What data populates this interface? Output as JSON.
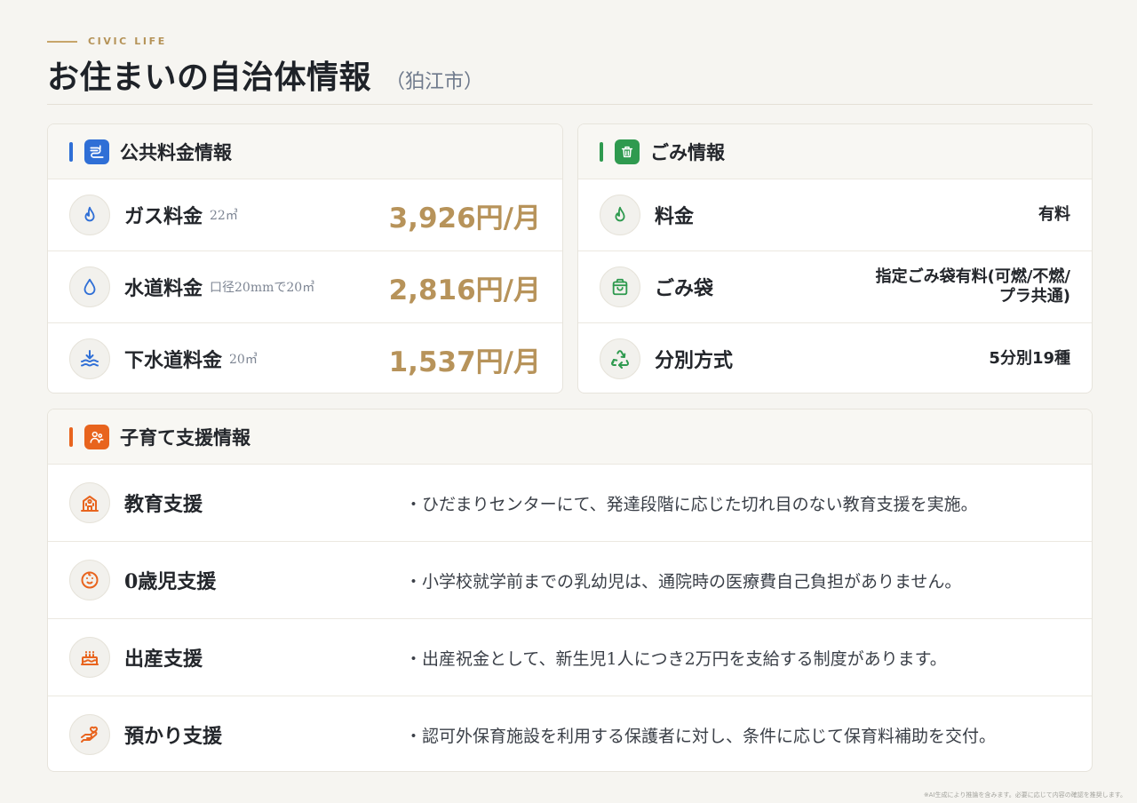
{
  "header": {
    "eyebrow": "CIVIC LIFE",
    "title": "お住まいの自治体情報",
    "subtitle": "（狛江市）"
  },
  "utilities": {
    "title": "公共料金情報",
    "accent_color": "#2f6fd6",
    "items": [
      {
        "label": "ガス料金",
        "note": "22㎥",
        "amount": "3,926円/月",
        "icon": "flame-icon"
      },
      {
        "label": "水道料金",
        "note": "口径20mmで20㎥",
        "amount": "2,816円/月",
        "icon": "water-drop-icon"
      },
      {
        "label": "下水道料金",
        "note": "20㎥",
        "amount": "1,537円/月",
        "icon": "sewage-icon"
      }
    ]
  },
  "garbage": {
    "title": "ごみ情報",
    "accent_color": "#2f9a4f",
    "items": [
      {
        "label": "料金",
        "value": "有料",
        "icon": "leaf-flame-icon"
      },
      {
        "label": "ごみ袋",
        "value_line1": "指定ごみ袋有料(可燃/不燃/",
        "value_line2": "プラ共通)",
        "icon": "bag-icon"
      },
      {
        "label": "分別方式",
        "value": "5分別19種",
        "icon": "recycle-icon"
      }
    ]
  },
  "childcare": {
    "title": "子育て支援情報",
    "accent_color": "#e8641e",
    "items": [
      {
        "label": "教育支援",
        "desc": "・ひだまりセンターにて、発達段階に応じた切れ目のない教育支援を実施。",
        "icon": "school-icon"
      },
      {
        "label": "0歳児支援",
        "desc": "・小学校就学前までの乳幼児は、通院時の医療費自己負担がありません。",
        "icon": "baby-icon"
      },
      {
        "label": "出産支援",
        "desc": "・出産祝金として、新生児1人につき2万円を支給する制度があります。",
        "icon": "cake-icon"
      },
      {
        "label": "預かり支援",
        "desc": "・認可外保育施設を利用する保護者に対し、条件に応じて保育料補助を交付。",
        "icon": "hand-care-icon"
      }
    ]
  },
  "footer": {
    "note": "※AI生成により推論を含みます。必要に応じて内容の確認を推奨します。"
  }
}
